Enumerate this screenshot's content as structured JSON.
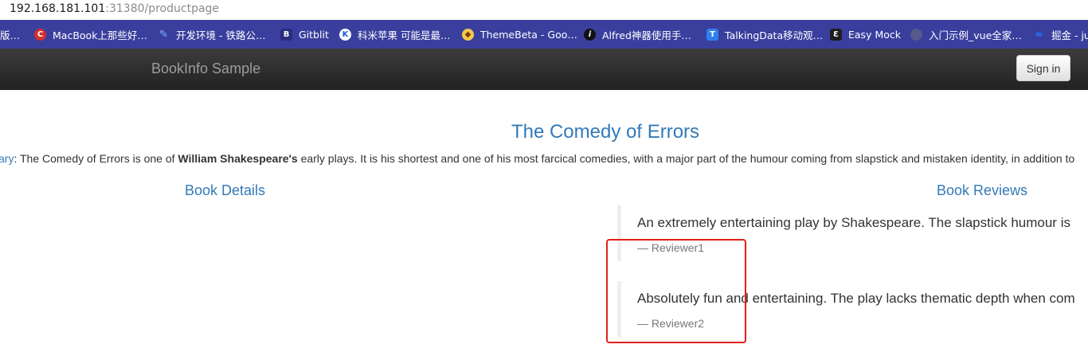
{
  "browser": {
    "url_host": "192.168.181.101",
    "url_rest": ":31380/productpage"
  },
  "bookmarks": [
    {
      "label": "版…"
    },
    {
      "label": "MacBook上那些好…",
      "icon": "red-c-icon"
    },
    {
      "label": "开发环境 - 铁路公…",
      "icon": "pen-icon"
    },
    {
      "label": "Gitblit",
      "icon": "gitblit-icon"
    },
    {
      "label": "科米苹果 可能是最…",
      "icon": "k-icon"
    },
    {
      "label": "ThemeBeta - Goo…",
      "icon": "themebeta-icon"
    },
    {
      "label": "Alfred神器使用手…",
      "icon": "info-icon"
    },
    {
      "label": "TalkingData移动观…",
      "icon": "t-icon"
    },
    {
      "label": "Easy Mock",
      "icon": "easymock-icon"
    },
    {
      "label": "入门示例_vue全家…",
      "icon": "globe-icon"
    },
    {
      "label": "掘金 - ju",
      "icon": "juejin-icon"
    }
  ],
  "navbar": {
    "brand": "BookInfo Sample",
    "signin_label": "Sign in"
  },
  "product": {
    "title": "The Comedy of Errors",
    "summary_link": "ary",
    "summary_pre": ": The Comedy of Errors is one of ",
    "summary_bold": "William Shakespeare's",
    "summary_post": " early plays. It is his shortest and one of his most farcical comedies, with a major part of the humour coming from slapstick and mistaken identity, in addition to"
  },
  "sections": {
    "details_heading": "Book Details",
    "reviews_heading": "Book Reviews"
  },
  "reviews": [
    {
      "text": "An extremely entertaining play by Shakespeare. The slapstick humour is",
      "reviewer": "— Reviewer1"
    },
    {
      "text": "Absolutely fun and entertaining. The play lacks thematic depth when com",
      "reviewer": "— Reviewer2"
    }
  ],
  "colors": {
    "link": "#337ab7",
    "bookmarks_bg": "#3a3f9e",
    "highlight": "#e0201c"
  }
}
